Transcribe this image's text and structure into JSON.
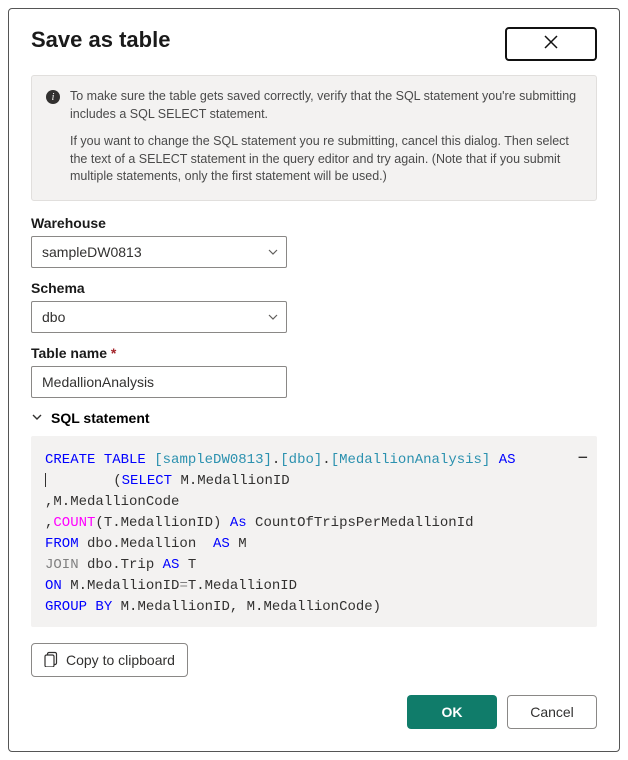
{
  "header": {
    "title": "Save as table"
  },
  "info": {
    "paragraph1": "To make sure the table gets saved correctly, verify that the SQL statement you're submitting includes a SQL SELECT statement.",
    "paragraph2": "If you want to change the SQL statement you re submitting, cancel this dialog. Then select the text of a SELECT statement in the query editor and try again. (Note that if you submit multiple statements, only the first statement will be used.)"
  },
  "fields": {
    "warehouse_label": "Warehouse",
    "warehouse_value": "sampleDW0813",
    "schema_label": "Schema",
    "schema_value": "dbo",
    "table_label": "Table name",
    "table_value": "MedallionAnalysis"
  },
  "sql": {
    "section_label": "SQL statement",
    "tokens": [
      {
        "t": "CREATE",
        "c": "kw-blue"
      },
      {
        "t": " "
      },
      {
        "t": "TABLE",
        "c": "kw-blue"
      },
      {
        "t": " "
      },
      {
        "t": "[sampleDW0813]",
        "c": "kw-teal"
      },
      {
        "t": "."
      },
      {
        "t": "[dbo]",
        "c": "kw-teal"
      },
      {
        "t": "."
      },
      {
        "t": "[MedallionAnalysis]",
        "c": "kw-teal"
      },
      {
        "t": " "
      },
      {
        "t": "AS",
        "c": "kw-blue"
      },
      {
        "t": "\n"
      },
      {
        "t": "        "
      },
      {
        "t": "(",
        "c": ""
      },
      {
        "t": "SELECT",
        "c": "kw-blue"
      },
      {
        "t": " M.MedallionID\n"
      },
      {
        "t": ","
      },
      {
        "t": "M.MedallionCode\n"
      },
      {
        "t": ","
      },
      {
        "t": "COUNT",
        "c": "kw-mag"
      },
      {
        "t": "(T.MedallionID) "
      },
      {
        "t": "As",
        "c": "kw-blue"
      },
      {
        "t": " CountOfTripsPerMedallionId\n"
      },
      {
        "t": "FROM",
        "c": "kw-blue"
      },
      {
        "t": " dbo.Medallion  "
      },
      {
        "t": "AS",
        "c": "kw-blue"
      },
      {
        "t": " M\n"
      },
      {
        "t": "JOIN",
        "c": "kw-gray"
      },
      {
        "t": " dbo.Trip "
      },
      {
        "t": "AS",
        "c": "kw-blue"
      },
      {
        "t": " T\n"
      },
      {
        "t": "ON",
        "c": "kw-blue"
      },
      {
        "t": " M.MedallionID"
      },
      {
        "t": "=",
        "c": "kw-gray"
      },
      {
        "t": "T.MedallionID\n"
      },
      {
        "t": "GROUP",
        "c": "kw-blue"
      },
      {
        "t": " "
      },
      {
        "t": "BY",
        "c": "kw-blue"
      },
      {
        "t": " M.MedallionID, M.MedallionCode)"
      }
    ]
  },
  "actions": {
    "copy_label": "Copy to clipboard",
    "ok_label": "OK",
    "cancel_label": "Cancel"
  }
}
